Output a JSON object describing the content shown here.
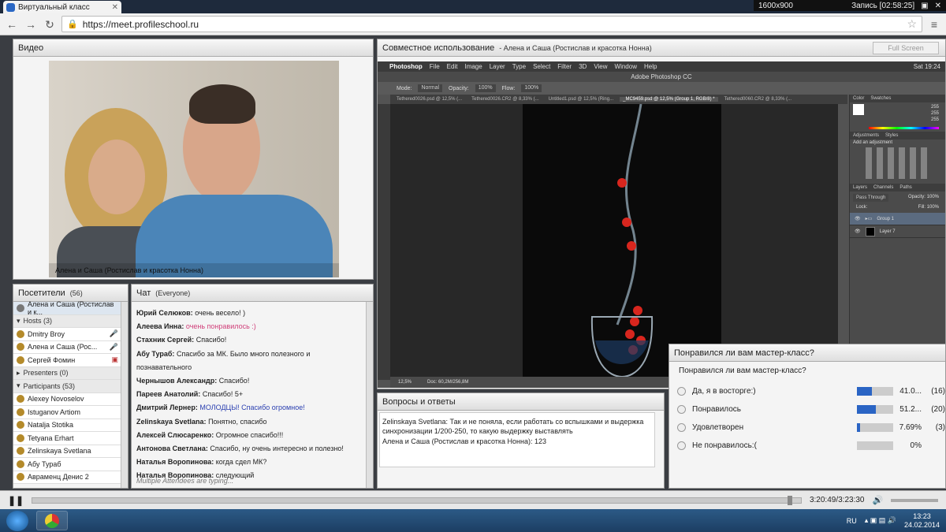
{
  "browser": {
    "tab_title": "Виртуальный класс",
    "url": "https://meet.profileschool.ru",
    "recorder": {
      "resolution": "1600x900",
      "record_label": "Запись [02:58:25]"
    }
  },
  "video": {
    "title": "Видео",
    "caption": "Алена и Саша (Ростислав и красотка Нонна)"
  },
  "attendees": {
    "title": "Посетители",
    "count": "(56)",
    "selected": "Алена и Саша (Ростислав и к...",
    "hosts_label": "Hosts (3)",
    "hosts": [
      "Dmitry Broy",
      "Алена и Саша (Рос...",
      "Сергей Фомин"
    ],
    "presenters_label": "Presenters (0)",
    "participants_label": "Participants (53)",
    "participants": [
      "Alexey Novoselov",
      "Istuganov Artiom",
      "Natalja Stotika",
      "Tetyana Erhart",
      "Zelinskaya Svetlana",
      "Абу Тураб",
      "Авраменц Денис 2"
    ]
  },
  "chat": {
    "title": "Чат",
    "scope": "(Everyone)",
    "messages": [
      {
        "name": "Юрий Селюков:",
        "text": "очень весело! )"
      },
      {
        "name": "Алеева Инна:",
        "text": "очень понравилось :)"
      },
      {
        "name": "Стахник Сергей:",
        "text": "Спасибо!"
      },
      {
        "name": "Абу Тураб:",
        "text": "Спасибо за МК. Было много полезного и познавательного"
      },
      {
        "name": "Чернышов Александр:",
        "text": "Спасибо!"
      },
      {
        "name": "Пареев Анатолий:",
        "text": "Спасибо! 5+"
      },
      {
        "name": "Дмитрий Лернер:",
        "text": "МОЛОДЦЫ! Спасибо огромное!"
      },
      {
        "name": "Zelinskaya Svetlana:",
        "text": "Понятно, спасибо"
      },
      {
        "name": "Алексей Слюсаренко:",
        "text": "Огромное спасибо!!!"
      },
      {
        "name": "Антонова Светлана:",
        "text": "Спасибо, ну очень интересно и полезно!"
      },
      {
        "name": "Наталья Воропинова:",
        "text": "когда сдел МК?"
      },
      {
        "name": "Наталья Воропинова:",
        "text": "следующий"
      }
    ],
    "typing": "Multiple Attendees are typing..."
  },
  "share": {
    "title": "Совместное использование",
    "subtitle": "- Алена и Саша (Ростислав и красотка Нонна)",
    "fullscreen": "Full Screen",
    "ps": {
      "menu": [
        "Photoshop",
        "File",
        "Edit",
        "Image",
        "Layer",
        "Type",
        "Select",
        "Filter",
        "3D",
        "View",
        "Window",
        "Help"
      ],
      "clock": "Sat 19:24",
      "app_title": "Adobe Photoshop CC",
      "options": [
        "Mode:",
        "Normal",
        "Opacity:",
        "100%",
        "Flow:",
        "100%"
      ],
      "tabs": [
        "Tethered0026.psd @ 12,5% (...",
        "Tethered0026.CR2 @ 8,33% (...",
        "Untitled1.psd @ 12,5% (Ring...",
        "_MC9459.psd @ 12,5% (Group 1, RGB/8) *",
        "Tethered0060.CR2 @ 8,33% (..."
      ],
      "zoom": "12,5%",
      "doc": "Doc: 60,2M/256,8M",
      "color_tabs": [
        "Color",
        "Swatches"
      ],
      "rgb": [
        "255",
        "255",
        "255"
      ],
      "adj_tabs": [
        "Adjustments",
        "Styles"
      ],
      "adj_label": "Add an adjustment",
      "layer_tabs": [
        "Layers",
        "Channels",
        "Paths"
      ],
      "blend": "Pass Through",
      "opacity": "Opacity: 100%",
      "lock": "Lock:",
      "fill": "Fill: 100%",
      "layers": [
        "Group 1",
        "Layer 7"
      ]
    }
  },
  "qa": {
    "title": "Вопросы и ответы",
    "question": "Zelinskaya Svetlana: Так и не поняла, если работать со вспышками и выдержка синхронизации 1/200-250, то какую выдержку выставлять",
    "answer": "Алена и Саша (Ростислав и красотка Нонна): 123"
  },
  "poll": {
    "title": "Понравился ли вам мастер-класс?",
    "question": "Понравился ли вам мастер-класс?",
    "options": [
      {
        "label": "Да, я в восторге:)",
        "pct": "41.0...",
        "count": "(16)",
        "fill": 0.41
      },
      {
        "label": "Понравилось",
        "pct": "51.2...",
        "count": "(20)",
        "fill": 0.512
      },
      {
        "label": "Удовлетворен",
        "pct": "7.69%",
        "count": "(3)",
        "fill": 0.0769
      },
      {
        "label": "Не понравилось:(",
        "pct": "0%",
        "count": "",
        "fill": 0
      }
    ]
  },
  "player": {
    "time": "3:20:49/3:23:30",
    "progress": 0.986
  },
  "taskbar": {
    "lang": "RU",
    "time": "13:23",
    "date": "24.02.2014"
  }
}
